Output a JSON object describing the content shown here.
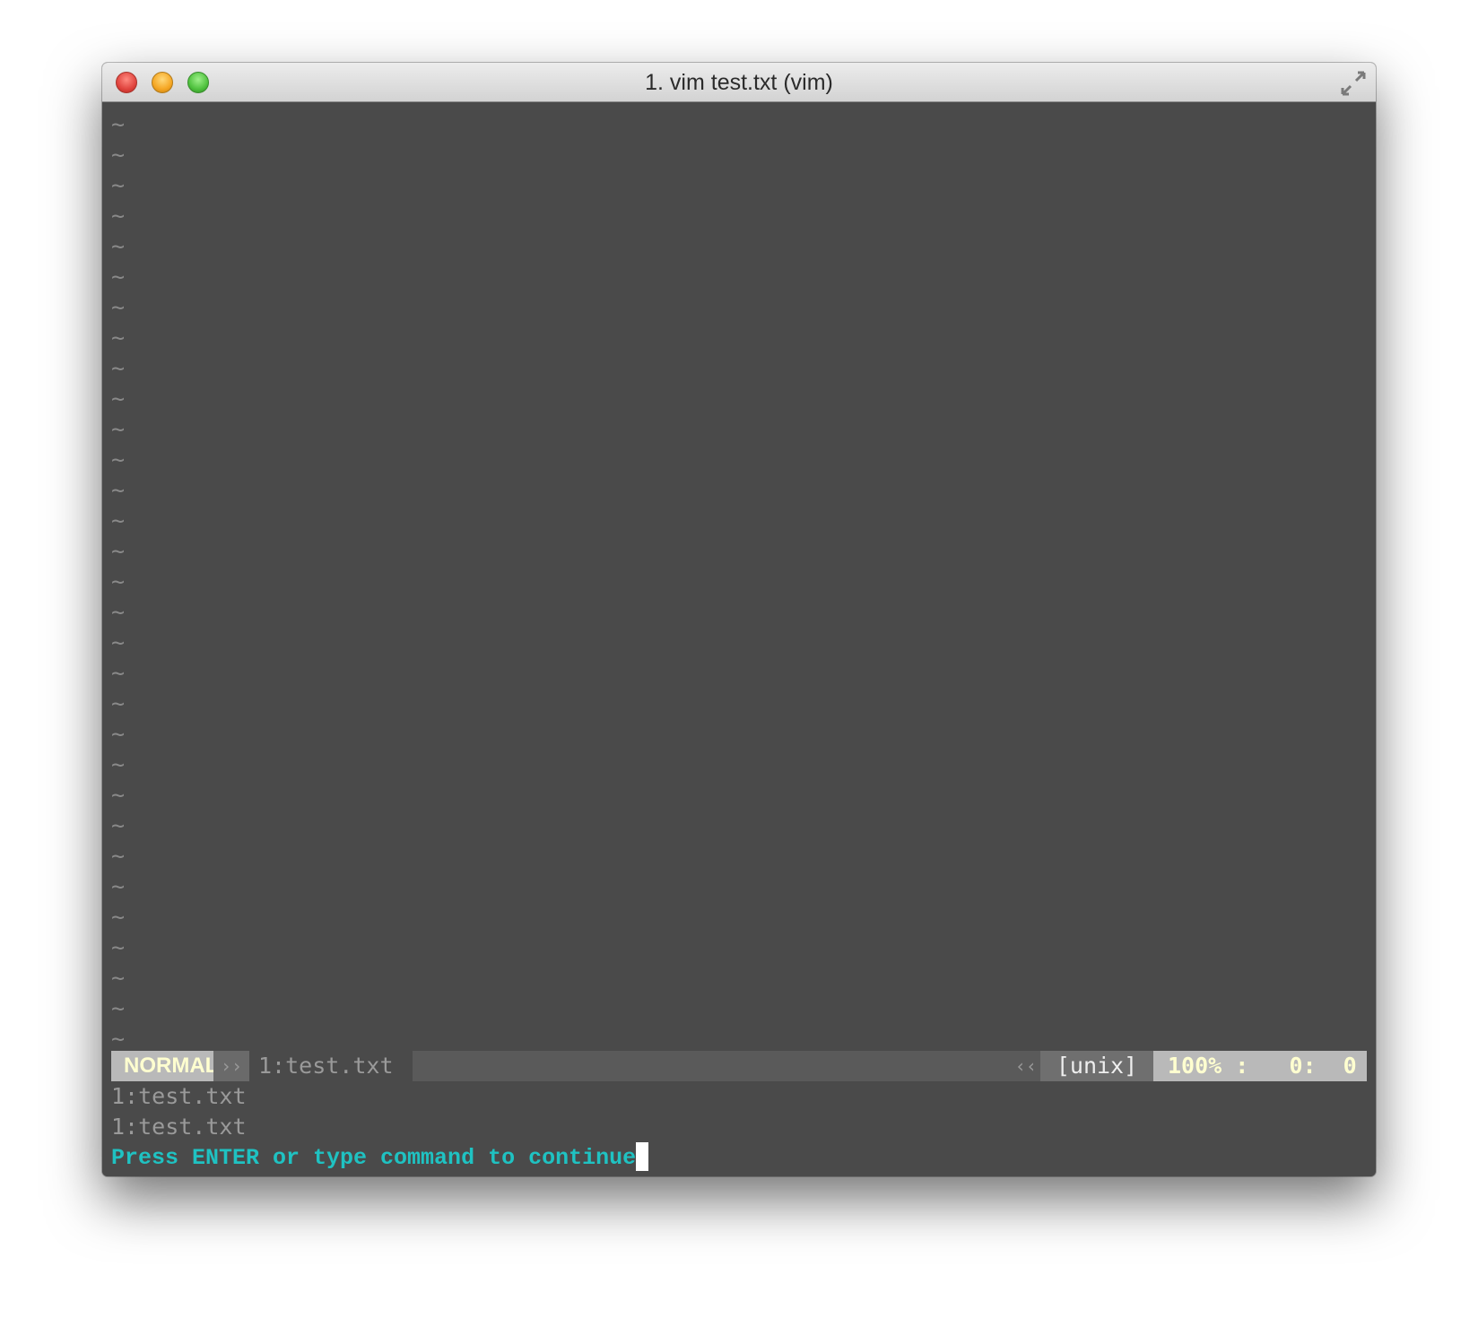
{
  "window": {
    "title": "1. vim test.txt (vim)"
  },
  "editor": {
    "empty_line_marker": "~",
    "empty_line_count": 31
  },
  "statusline": {
    "mode": "NORMAL",
    "left_separator": "››",
    "buffer": "1:test.txt",
    "right_separator": "‹‹",
    "fileformat": "[unix]",
    "position_separator": "‹",
    "position": "100% :   0:  0"
  },
  "messages": [
    "1:test.txt",
    "1:test.txt"
  ],
  "prompt": {
    "text": "Press ENTER or type command to continue"
  },
  "colors": {
    "background": "#4a4a4a",
    "mode_bg": "#b9b9b9",
    "mode_fg": "#ffffd0",
    "prompt": "#1fc2c2",
    "tilde": "#8a8a8a"
  }
}
